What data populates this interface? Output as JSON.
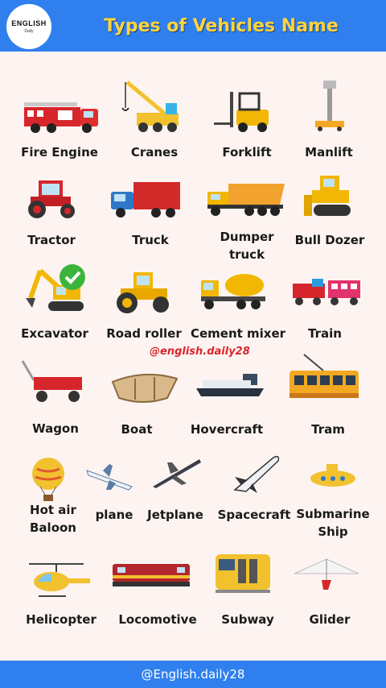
{
  "brand": {
    "logo_main": "ENGLISH",
    "logo_sub": "Daily"
  },
  "header": {
    "title": "Types of Vehicles Name"
  },
  "watermark": "@english.daily28",
  "footer": {
    "handle": "@English.daily28"
  },
  "vehicles": [
    {
      "name": "Fire Engine",
      "icon": "fire-engine-icon"
    },
    {
      "name": "Cranes",
      "icon": "crane-icon"
    },
    {
      "name": "Forklift",
      "icon": "forklift-icon"
    },
    {
      "name": "Manlift",
      "icon": "manlift-icon"
    },
    {
      "name": "Tractor",
      "icon": "tractor-icon"
    },
    {
      "name": "Truck",
      "icon": "truck-icon"
    },
    {
      "name": "Dumper\ntruck",
      "icon": "dumper-truck-icon"
    },
    {
      "name": "Bull Dozer",
      "icon": "bulldozer-icon"
    },
    {
      "name": "Excavator",
      "icon": "excavator-icon"
    },
    {
      "name": "Road roller",
      "icon": "road-roller-icon"
    },
    {
      "name": "Cement mixer",
      "icon": "cement-mixer-icon"
    },
    {
      "name": "Train",
      "icon": "train-icon"
    },
    {
      "name": "Wagon",
      "icon": "wagon-icon"
    },
    {
      "name": "Boat",
      "icon": "boat-icon"
    },
    {
      "name": "Hovercraft",
      "icon": "hovercraft-icon"
    },
    {
      "name": "Tram",
      "icon": "tram-icon"
    },
    {
      "name": "Hot air\nBaloon",
      "icon": "hot-air-balloon-icon"
    },
    {
      "name": "plane",
      "icon": "plane-icon"
    },
    {
      "name": "Jetplane",
      "icon": "jetplane-icon"
    },
    {
      "name": "Spacecraft",
      "icon": "spacecraft-icon"
    },
    {
      "name": "Submarine\nShip",
      "icon": "submarine-icon"
    },
    {
      "name": "Helicopter",
      "icon": "helicopter-icon"
    },
    {
      "name": "Locomotive",
      "icon": "locomotive-icon"
    },
    {
      "name": "Subway",
      "icon": "subway-icon"
    },
    {
      "name": "Glider",
      "icon": "glider-icon"
    }
  ],
  "colors": {
    "header_bg": "#2f80ee",
    "title": "#ffd43b",
    "page_bg": "#fdf4f1",
    "watermark": "#d9262d"
  }
}
